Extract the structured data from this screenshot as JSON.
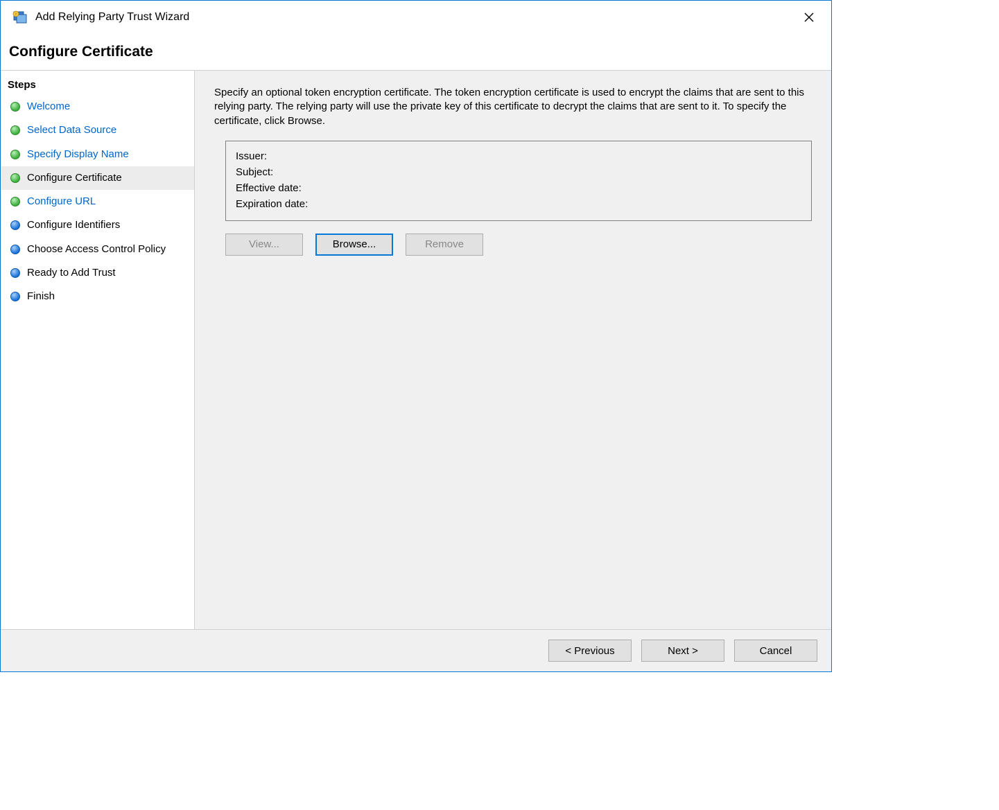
{
  "window": {
    "title": "Add Relying Party Trust Wizard"
  },
  "header": {
    "title": "Configure Certificate"
  },
  "sidebar": {
    "header": "Steps",
    "items": [
      {
        "label": "Welcome",
        "bullet": "green",
        "state": "link"
      },
      {
        "label": "Select Data Source",
        "bullet": "green",
        "state": "link"
      },
      {
        "label": "Specify Display Name",
        "bullet": "green",
        "state": "link"
      },
      {
        "label": "Configure Certificate",
        "bullet": "green",
        "state": "current"
      },
      {
        "label": "Configure URL",
        "bullet": "green",
        "state": "link"
      },
      {
        "label": "Configure Identifiers",
        "bullet": "blue",
        "state": "future"
      },
      {
        "label": "Choose Access Control Policy",
        "bullet": "blue",
        "state": "future"
      },
      {
        "label": "Ready to Add Trust",
        "bullet": "blue",
        "state": "future"
      },
      {
        "label": "Finish",
        "bullet": "blue",
        "state": "future"
      }
    ]
  },
  "main": {
    "instructions": "Specify an optional token encryption certificate.  The token encryption certificate is used to encrypt the claims that are sent to this relying party.  The relying party will use the private key of this certificate to decrypt the claims that are sent to it.  To specify the certificate, click Browse.",
    "cert_fields": {
      "issuer_label": "Issuer:",
      "subject_label": "Subject:",
      "effective_label": "Effective date:",
      "expiration_label": "Expiration date:"
    },
    "buttons": {
      "view": "View...",
      "browse": "Browse...",
      "remove": "Remove"
    }
  },
  "footer": {
    "previous": "< Previous",
    "next": "Next >",
    "cancel": "Cancel"
  }
}
